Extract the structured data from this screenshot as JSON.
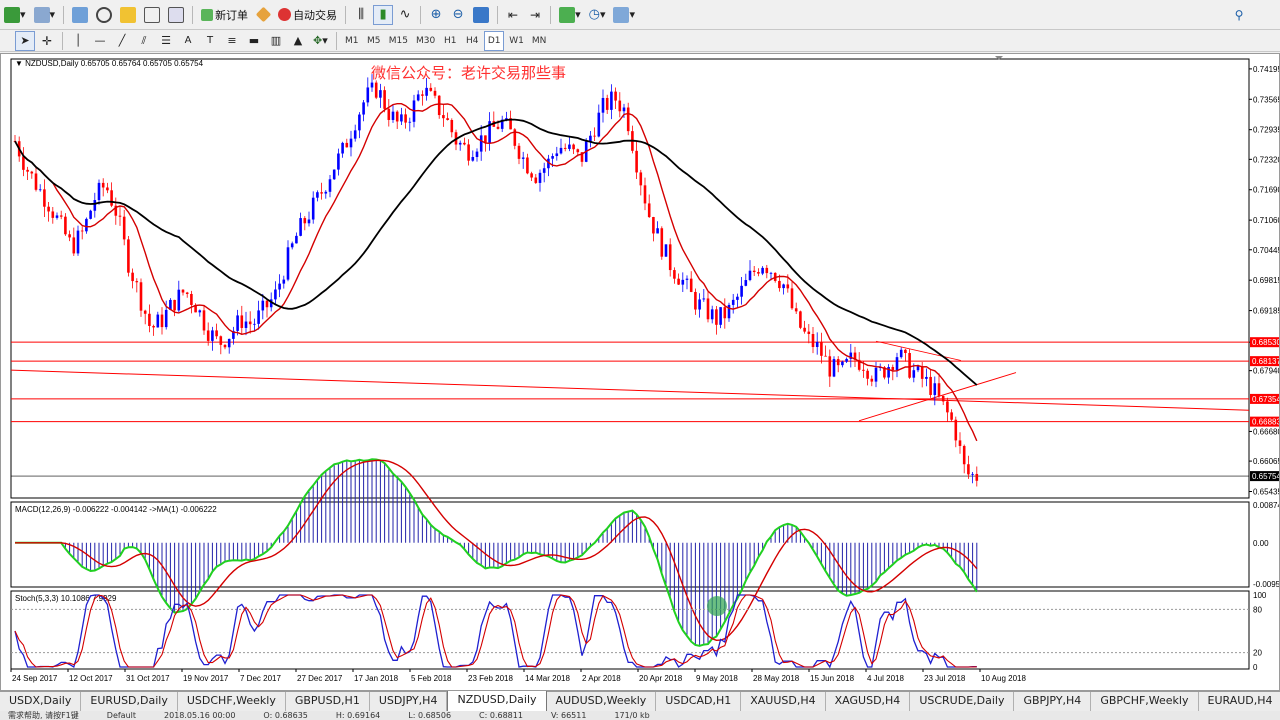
{
  "toolbar": {
    "new_order_label": "新订单",
    "auto_trade_label": "自动交易",
    "timeframes": [
      "M1",
      "M5",
      "M15",
      "M30",
      "H1",
      "H4",
      "D1",
      "W1",
      "MN"
    ],
    "active_timeframe": "D1",
    "icons": [
      "new-chart-icon",
      "profiles-icon",
      "market-watch-icon",
      "navigator-icon",
      "favorites-icon",
      "terminal-icon",
      "tester-icon",
      "expert-icon",
      "bar-chart-icon",
      "candle-chart-icon",
      "line-chart-icon",
      "zoom-in-icon",
      "zoom-out-icon",
      "tile-icon",
      "autoscroll-icon",
      "chart-shift-icon",
      "indicators-icon",
      "periods-icon",
      "templates-icon",
      "search-icon"
    ],
    "draw_icons": [
      "cursor-icon",
      "crosshair-icon",
      "vertical-line-icon",
      "horizontal-line-icon",
      "trendline-icon",
      "channel-icon",
      "fibonacci-icon",
      "text-icon",
      "label-icon",
      "rectangle-icon",
      "gann-icon",
      "triangle-icon",
      "arrow-icon"
    ]
  },
  "chart": {
    "header": "NZDUSD,Daily  0.65705 0.65764 0.65705 0.65754",
    "watermark": "微信公众号：老许交易那些事",
    "macd_label": "MACD(12,26,9) -0.006222 -0.004142 ->MA(1) -0.006222",
    "stoch_label": "Stoch(5,3,3) 10.1086 7.9929",
    "price_ticks": [
      "0.74195",
      "0.73565",
      "0.72935",
      "0.72320",
      "0.71690",
      "0.71060",
      "0.70445",
      "0.69815",
      "0.69185",
      "0.68530",
      "0.67940",
      "0.66680",
      "0.66065",
      "0.65435"
    ],
    "level_tags": [
      "0.68530",
      "0.68137",
      "0.67354",
      "0.66883",
      "0.65754"
    ],
    "macd_ticks": [
      "0.00874",
      "0.00",
      "-0.00955"
    ],
    "stoch_ticks": [
      "100",
      "80",
      "20",
      "0"
    ],
    "date_ticks": [
      "24 Sep 2017",
      "12 Oct 2017",
      "31 Oct 2017",
      "19 Nov 2017",
      "7 Dec 2017",
      "27 Dec 2017",
      "17 Jan 2018",
      "5 Feb 2018",
      "23 Feb 2018",
      "14 Mar 2018",
      "2 Apr 2018",
      "20 Apr 2018",
      "9 May 2018",
      "28 May 2018",
      "15 Jun 2018",
      "4 Jul 2018",
      "23 Jul 2018",
      "10 Aug 2018"
    ],
    "colors": {
      "bull": "#0000ff",
      "bear": "#ff0000",
      "ma_fast": "#d40000",
      "ma_slow": "#000000",
      "macd_hist": "#2222aa",
      "macd_main": "#20d020",
      "macd_signal": "#d40000",
      "stoch_main": "#2020d0",
      "stoch_signal": "#d40000",
      "level": "#ff0000",
      "watermark": "#ff3030"
    }
  },
  "chart_data": {
    "type": "candlestick",
    "symbol": "NZDUSD",
    "timeframe": "Daily",
    "close": [
      0.727,
      0.7215,
      0.7175,
      0.714,
      0.7095,
      0.705,
      0.708,
      0.715,
      0.718,
      0.712,
      0.702,
      0.695,
      0.688,
      0.69,
      0.6935,
      0.696,
      0.693,
      0.688,
      0.685,
      0.687,
      0.69,
      0.689,
      0.692,
      0.695,
      0.702,
      0.708,
      0.712,
      0.716,
      0.721,
      0.725,
      0.731,
      0.736,
      0.738,
      0.733,
      0.73,
      0.733,
      0.738,
      0.735,
      0.732,
      0.727,
      0.725,
      0.727,
      0.729,
      0.731,
      0.728,
      0.723,
      0.72,
      0.722,
      0.726,
      0.725,
      0.723,
      0.729,
      0.734,
      0.736,
      0.733,
      0.722,
      0.712,
      0.706,
      0.701,
      0.698,
      0.694,
      0.692,
      0.69,
      0.6915,
      0.695,
      0.699,
      0.702,
      0.7,
      0.697,
      0.69,
      0.686,
      0.684,
      0.68,
      0.679,
      0.682,
      0.681,
      0.678,
      0.68,
      0.683,
      0.68,
      0.678,
      0.676,
      0.672,
      0.668,
      0.658,
      0.6575
    ],
    "levels": [
      0.6853,
      0.68137,
      0.67354,
      0.66883,
      0.65754
    ],
    "macd": {
      "main": -0.006222,
      "signal": -0.004142,
      "ma": -0.006222,
      "range": [
        -0.00955,
        0.00874
      ]
    },
    "stoch": {
      "main": 10.1086,
      "signal": 7.9929,
      "range": [
        0,
        100
      ]
    }
  },
  "tabs": [
    "USDX,Daily",
    "EURUSD,Daily",
    "USDCHF,Weekly",
    "GBPUSD,H1",
    "USDJPY,H4",
    "NZDUSD,Daily",
    "AUDUSD,Weekly",
    "USDCAD,H1",
    "XAUUSD,H4",
    "XAGUSD,H4",
    "USCRUDE,Daily",
    "GBPJPY,H4",
    "GBPCHF,Weekly",
    "EURAUD,H4"
  ],
  "active_tab": "NZDUSD,Daily",
  "status": {
    "help": "需求帮助, 请按F1键",
    "profile": "Default",
    "datetime": "2018.05.16 00:00",
    "open": "O: 0.68635",
    "high": "H: 0.69164",
    "low": "L: 0.68506",
    "close": "C: 0.68811",
    "volume": "V: 66511",
    "traffic": "171/0 kb"
  }
}
